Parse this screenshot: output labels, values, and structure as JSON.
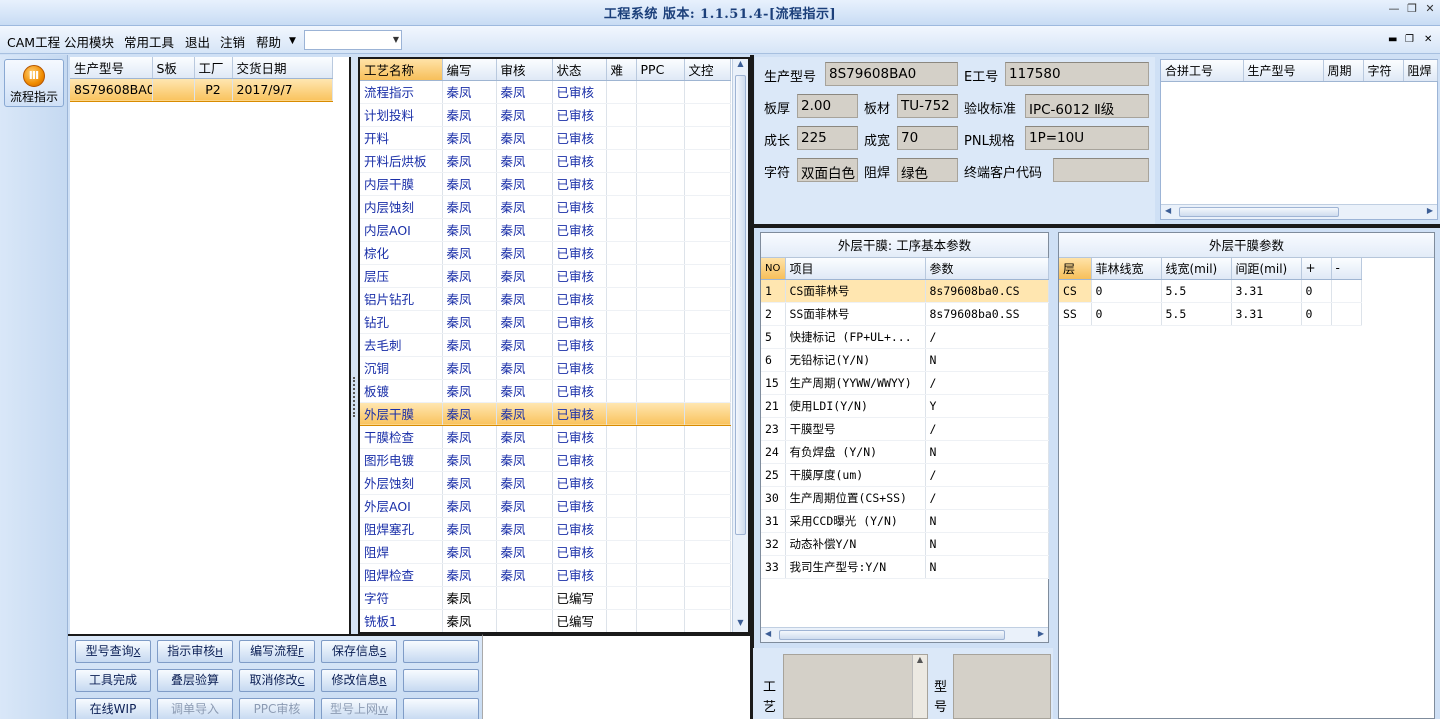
{
  "window": {
    "title": "工程系统 版本: 1.1.51.4-[流程指示]"
  },
  "menu": [
    "CAM工程",
    "公用模块",
    "常用工具",
    "退出",
    "注销",
    "帮助"
  ],
  "sidebar": {
    "flow_button": "流程指示",
    "flow_icon": "flow-icon"
  },
  "order_grid": {
    "headers": [
      "生产型号",
      "S板",
      "工厂",
      "交货日期"
    ],
    "rows": [
      {
        "model": "8S79608BA0",
        "s": "",
        "factory": "P2",
        "date": "2017/9/7"
      }
    ]
  },
  "process_grid": {
    "headers": [
      "工艺名称",
      "编写",
      "审核",
      "状态",
      "难",
      "PPC",
      "文控"
    ],
    "selected_index": 14,
    "rows": [
      [
        "流程指示",
        "秦凤",
        "秦凤",
        "已审核"
      ],
      [
        "计划投料",
        "秦凤",
        "秦凤",
        "已审核"
      ],
      [
        "开料",
        "秦凤",
        "秦凤",
        "已审核"
      ],
      [
        "开料后烘板",
        "秦凤",
        "秦凤",
        "已审核"
      ],
      [
        "内层干膜",
        "秦凤",
        "秦凤",
        "已审核"
      ],
      [
        "内层蚀刻",
        "秦凤",
        "秦凤",
        "已审核"
      ],
      [
        "内层AOI",
        "秦凤",
        "秦凤",
        "已审核"
      ],
      [
        "棕化",
        "秦凤",
        "秦凤",
        "已审核"
      ],
      [
        "层压",
        "秦凤",
        "秦凤",
        "已审核"
      ],
      [
        "铝片钻孔",
        "秦凤",
        "秦凤",
        "已审核"
      ],
      [
        "钻孔",
        "秦凤",
        "秦凤",
        "已审核"
      ],
      [
        "去毛刺",
        "秦凤",
        "秦凤",
        "已审核"
      ],
      [
        "沉铜",
        "秦凤",
        "秦凤",
        "已审核"
      ],
      [
        "板镀",
        "秦凤",
        "秦凤",
        "已审核"
      ],
      [
        "外层干膜",
        "秦凤",
        "秦凤",
        "已审核"
      ],
      [
        "干膜检查",
        "秦凤",
        "秦凤",
        "已审核"
      ],
      [
        "图形电镀",
        "秦凤",
        "秦凤",
        "已审核"
      ],
      [
        "外层蚀刻",
        "秦凤",
        "秦凤",
        "已审核"
      ],
      [
        "外层AOI",
        "秦凤",
        "秦凤",
        "已审核"
      ],
      [
        "阻焊塞孔",
        "秦凤",
        "秦凤",
        "已审核"
      ],
      [
        "阻焊",
        "秦凤",
        "秦凤",
        "已审核"
      ],
      [
        "阻焊检查",
        "秦凤",
        "秦凤",
        "已审核"
      ],
      [
        "字符",
        "秦凤",
        "",
        "已编写"
      ],
      [
        "铣板1",
        "秦凤",
        "",
        "已编写"
      ]
    ]
  },
  "buttons": {
    "row1": [
      {
        "label": "型号查询",
        "key": "X"
      },
      {
        "label": "指示审核",
        "key": "H"
      },
      {
        "label": "编写流程",
        "key": "F"
      },
      {
        "label": "保存信息",
        "key": "S"
      },
      {
        "label": "",
        "key": ""
      }
    ],
    "row2": [
      {
        "label": "工具完成",
        "key": ""
      },
      {
        "label": "叠层验算",
        "key": ""
      },
      {
        "label": "取消修改",
        "key": "C"
      },
      {
        "label": "修改信息",
        "key": "R"
      },
      {
        "label": "",
        "key": ""
      }
    ],
    "row3": [
      {
        "label": "在线WIP",
        "key": ""
      },
      {
        "label": "调单导入",
        "key": ""
      },
      {
        "label": "PPC审核",
        "key": ""
      },
      {
        "label": "型号上网",
        "key": "W"
      },
      {
        "label": "",
        "key": ""
      }
    ]
  },
  "info": {
    "model_label": "生产型号",
    "model": "8S79608BA0",
    "e_label": "E工号",
    "e_no": "117580",
    "thick_label": "板厚",
    "thick": "2.00",
    "mat_label": "板材",
    "mat": "TU-752",
    "std_label": "验收标准",
    "std": "IPC-6012 Ⅱ级",
    "len_label": "成长",
    "len": "225",
    "wid_label": "成宽",
    "wid": "70",
    "pnl_label": "PNL规格",
    "pnl": "1P=10U",
    "char_label": "字符",
    "char": "双面白色",
    "mask_label": "阻焊",
    "mask": "绿色",
    "cust_label": "终端客户代码",
    "cust": ""
  },
  "merge_grid": {
    "headers": [
      "合拼工号",
      "生产型号",
      "周期",
      "字符",
      "阻焊"
    ]
  },
  "basic_params": {
    "title": "外层干膜: 工序基本参数",
    "headers": [
      "NO",
      "项目",
      "参数"
    ],
    "rows": [
      [
        "1",
        "CS面菲林号",
        "8s79608ba0.CS"
      ],
      [
        "2",
        "SS面菲林号",
        "8s79608ba0.SS"
      ],
      [
        "5",
        "快捷标记 (FP+UL+...",
        "/"
      ],
      [
        "6",
        "无铅标记(Y/N)",
        "N"
      ],
      [
        "15",
        "生产周期(YYWW/WWYY)",
        "/"
      ],
      [
        "21",
        "使用LDI(Y/N)",
        "Y"
      ],
      [
        "23",
        "干膜型号",
        "/"
      ],
      [
        "24",
        "有负焊盘 (Y/N)",
        "N"
      ],
      [
        "25",
        "干膜厚度(um)",
        "/"
      ],
      [
        "30",
        "生产周期位置(CS+SS)",
        "/"
      ],
      [
        "31",
        "采用CCD曝光 (Y/N)",
        "N"
      ],
      [
        "32",
        "动态补偿Y/N",
        "N"
      ],
      [
        "33",
        "我司生产型号:Y/N",
        "N"
      ]
    ]
  },
  "film_params": {
    "title": "外层干膜参数",
    "headers": [
      "层",
      "菲林线宽",
      "线宽(mil)",
      "间距(mil)",
      "+",
      "-"
    ],
    "rows": [
      [
        "CS",
        "0",
        "5.5",
        "3.31",
        "0",
        ""
      ],
      [
        "SS",
        "0",
        "5.5",
        "3.31",
        "0",
        ""
      ]
    ]
  },
  "bottom_labels": {
    "craft": "工艺",
    "model": "型号"
  }
}
